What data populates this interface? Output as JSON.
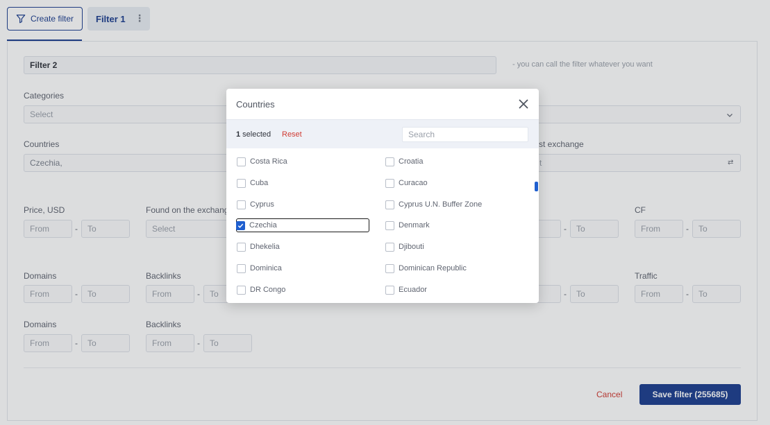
{
  "toolbar": {
    "create_filter_label": "Create filter",
    "tab_label": "Filter 1",
    "tab_menu_icon": "more-vertical-icon"
  },
  "form": {
    "name_value": "Filter 2",
    "name_hint": "- you can call the filter whatever you want",
    "categories_label": "Categories",
    "categories_placeholder": "Select",
    "countries_label": "Countries",
    "countries_value": "Czechia,",
    "exchange_label_fragment": "st exchange",
    "exchange_value_fragment": "t",
    "price_label": "Price, USD",
    "found_label": "Found on the exchange",
    "found_placeholder": "Select",
    "cf_label": "CF",
    "domains_label": "Domains",
    "backlinks_label": "Backlinks",
    "traffic_label": "Traffic",
    "domains2_label": "Domains",
    "backlinks2_label": "Backlinks",
    "from_placeholder": "From",
    "to_placeholder": "To",
    "dash": "-"
  },
  "footer": {
    "cancel_label": "Cancel",
    "save_label": "Save filter (255685)"
  },
  "modal": {
    "title": "Countries",
    "selected_count": "1",
    "selected_suffix": " selected",
    "reset_label": "Reset",
    "search_placeholder": "Search",
    "options_left": [
      {
        "label": "Costa Rica",
        "checked": false
      },
      {
        "label": "Cuba",
        "checked": false
      },
      {
        "label": "Cyprus",
        "checked": false
      },
      {
        "label": "Czechia",
        "checked": true
      },
      {
        "label": "Dhekelia",
        "checked": false
      },
      {
        "label": "Dominica",
        "checked": false
      },
      {
        "label": "DR Congo",
        "checked": false
      }
    ],
    "options_right": [
      {
        "label": "Croatia",
        "checked": false
      },
      {
        "label": "Curacao",
        "checked": false
      },
      {
        "label": "Cyprus U.N. Buffer Zone",
        "checked": false
      },
      {
        "label": "Denmark",
        "checked": false
      },
      {
        "label": "Djibouti",
        "checked": false
      },
      {
        "label": "Dominican Republic",
        "checked": false
      },
      {
        "label": "Ecuador",
        "checked": false
      }
    ]
  },
  "colors": {
    "primary": "#1d3f8f",
    "danger": "#d03b33",
    "checkbox_checked": "#1f5fcf"
  }
}
